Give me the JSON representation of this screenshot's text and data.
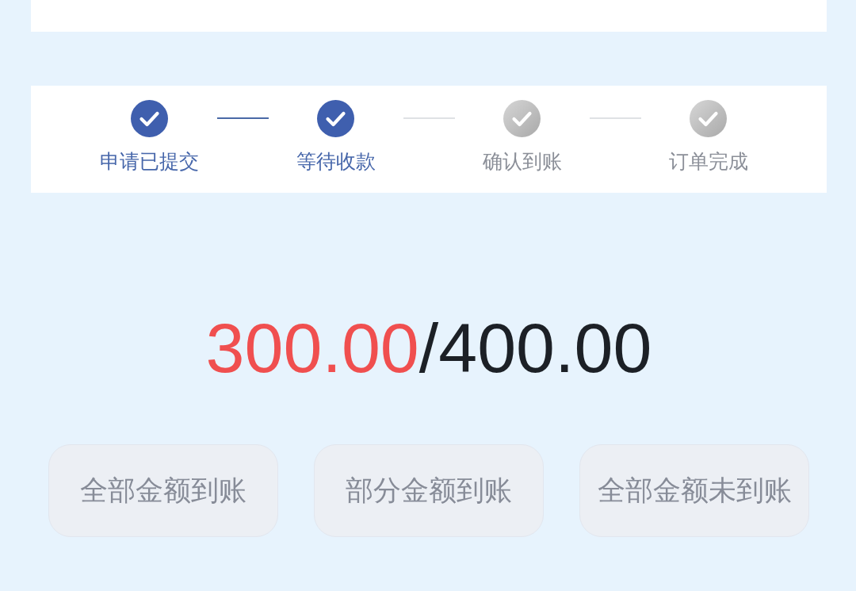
{
  "steps": [
    {
      "label": "申请已提交",
      "done": true
    },
    {
      "label": "等待收款",
      "done": true
    },
    {
      "label": "确认到账",
      "done": false
    },
    {
      "label": "订单完成",
      "done": false
    }
  ],
  "amount": {
    "received": "300.00",
    "separator": "/",
    "total": "400.00"
  },
  "actions": [
    {
      "label": "全部金额到账"
    },
    {
      "label": "部分金额到账"
    },
    {
      "label": "全部金额未到账"
    }
  ]
}
